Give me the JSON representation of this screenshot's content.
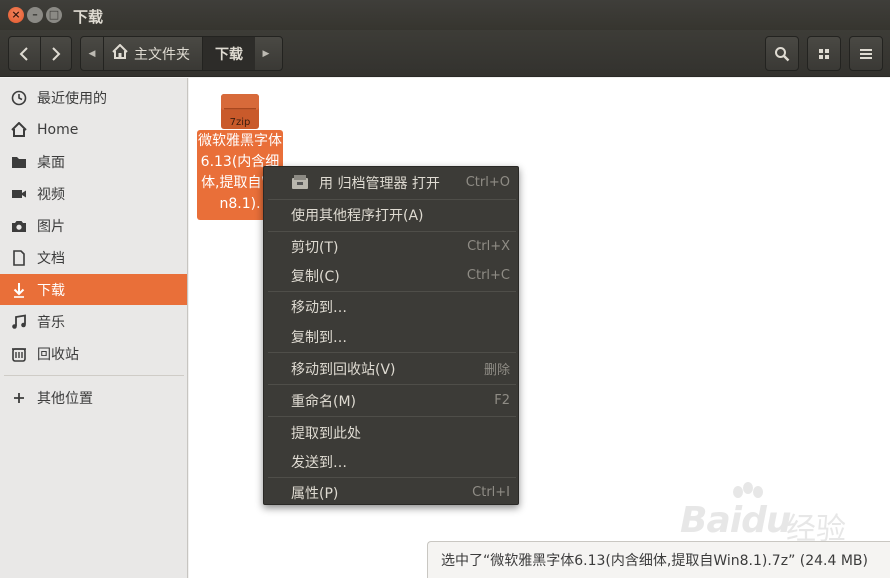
{
  "window": {
    "title": "下载"
  },
  "toolbar": {
    "back_icon": "chevron-left-icon",
    "forward_icon": "chevron-right-icon",
    "path": [
      {
        "label": "主文件夹",
        "icon": "home-icon"
      },
      {
        "label": "下载"
      }
    ],
    "search_icon": "search-icon",
    "view_icon": "grid-view-icon",
    "menu_icon": "hamburger-menu-icon"
  },
  "sidebar": {
    "items": [
      {
        "label": "最近使用的",
        "icon": "clock-icon"
      },
      {
        "label": "Home",
        "icon": "home-icon"
      },
      {
        "label": "桌面",
        "icon": "folder-icon"
      },
      {
        "label": "视频",
        "icon": "video-camera-icon"
      },
      {
        "label": "图片",
        "icon": "camera-icon"
      },
      {
        "label": "文档",
        "icon": "document-icon"
      },
      {
        "label": "下载",
        "icon": "download-icon",
        "selected": true
      },
      {
        "label": "音乐",
        "icon": "music-icon"
      },
      {
        "label": "回收站",
        "icon": "trash-icon"
      }
    ],
    "other_locations": {
      "label": "其他位置",
      "icon": "plus-icon"
    }
  },
  "file": {
    "icon_text": "7zip",
    "name": "微软雅黑字体6.13(内含细体,提取自Win8.1).",
    "icon": "7zip-archive-icon"
  },
  "context_menu": {
    "items": [
      {
        "label": "用 归档管理器 打开",
        "shortcut": "Ctrl+O",
        "icon": "archive-manager-icon"
      },
      {
        "label": "使用其他程序打开(A)",
        "shortcut": ""
      },
      {
        "label": "剪切(T)",
        "shortcut": "Ctrl+X"
      },
      {
        "label": "复制(C)",
        "shortcut": "Ctrl+C"
      },
      {
        "label": "移动到…",
        "shortcut": ""
      },
      {
        "label": "复制到…",
        "shortcut": ""
      },
      {
        "label": "移动到回收站(V)",
        "shortcut": "删除"
      },
      {
        "label": "重命名(M)",
        "shortcut": "F2"
      },
      {
        "label": "提取到此处",
        "shortcut": ""
      },
      {
        "label": "发送到…",
        "shortcut": ""
      },
      {
        "label": "属性(P)",
        "shortcut": "Ctrl+I"
      }
    ]
  },
  "status": {
    "text": "选中了“微软雅黑字体6.13(内含细体,提取自Win8.1).7z” (24.4 MB)"
  },
  "watermark": {
    "text": "Baidu",
    "cn": "经验"
  },
  "colors": {
    "accent": "#e96f39",
    "menu_bg": "#3c3b37",
    "titlebar": "#3c3b37"
  }
}
